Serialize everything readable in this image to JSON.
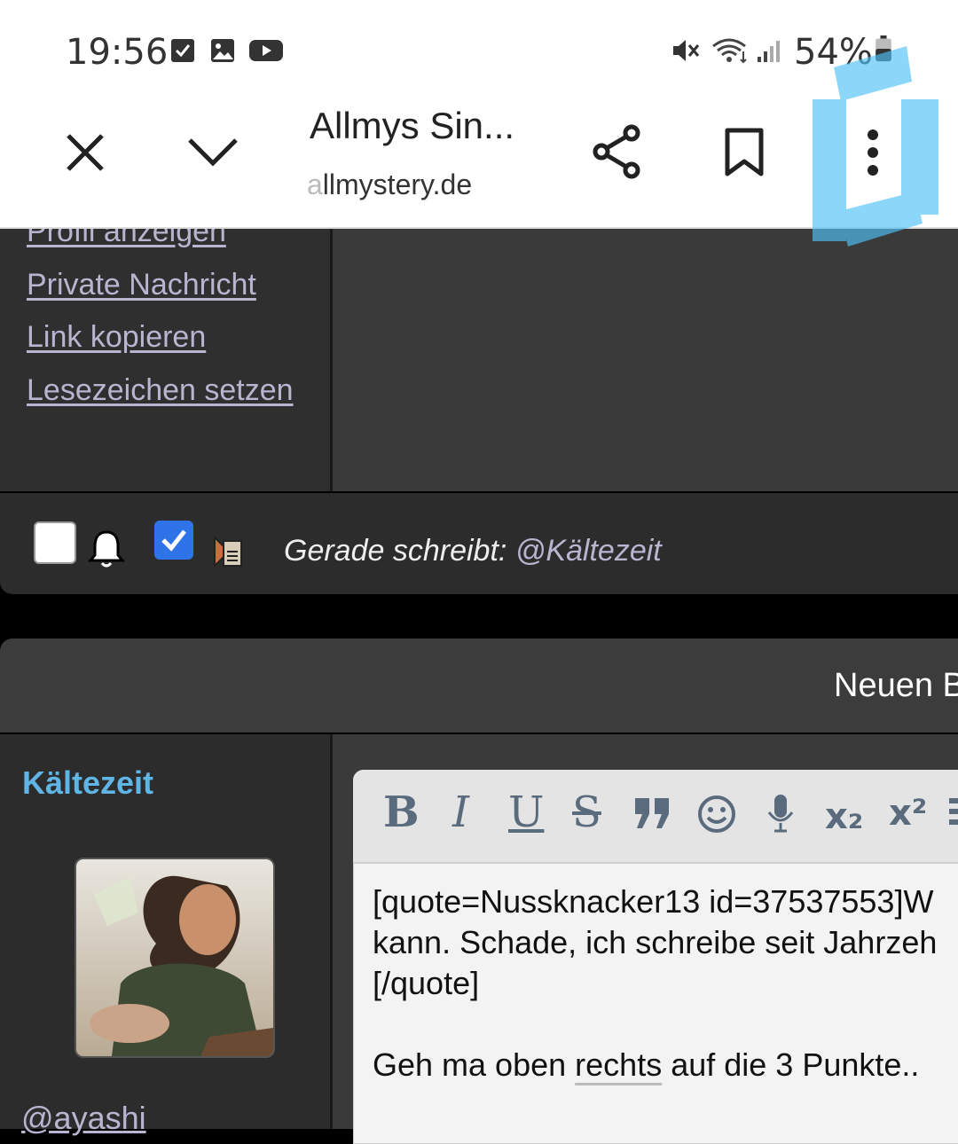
{
  "status_bar": {
    "time": "19:56",
    "battery_percent": "54%",
    "battery_level": 0.54,
    "icons": [
      "checkbox-notification-icon",
      "gallery-notification-icon",
      "youtube-notification-icon",
      "mute-icon",
      "wifi-icon",
      "signal-icon",
      "battery-icon"
    ]
  },
  "toolbar": {
    "title": "Allmys Sin...",
    "url_prefix": "a",
    "url_rest": "llmystery.de",
    "icons": [
      "close-icon",
      "chevron-down-icon",
      "share-icon",
      "bookmark-icon",
      "more-vert-icon"
    ]
  },
  "post_menu": {
    "items": [
      {
        "label": "Profil anzeigen"
      },
      {
        "label": "Private Nachricht"
      },
      {
        "label": "Link kopieren"
      },
      {
        "label": "Lesezeichen setzen"
      }
    ]
  },
  "thread_options": {
    "notify_checked": false,
    "subscribe_checked": true,
    "typing_label": "Gerade schreibt:",
    "typing_user": "@Kältezeit"
  },
  "reply": {
    "header_text": "Neuen B",
    "author_name": "Kältezeit",
    "author_handle": "@ayashi",
    "editor_buttons": [
      {
        "label": "B",
        "name": "bold-button"
      },
      {
        "label": "I",
        "name": "italic-button"
      },
      {
        "label": "U",
        "name": "underline-button"
      },
      {
        "label": "S",
        "name": "strikethrough-button"
      },
      {
        "label": "❞",
        "name": "quote-button"
      },
      {
        "label": "☺",
        "name": "emoji-button"
      },
      {
        "label": "🎤",
        "name": "microphone-button"
      },
      {
        "label": "x₂",
        "name": "subscript-button"
      },
      {
        "label": "x²",
        "name": "superscript-button"
      }
    ],
    "editor_line1": "[quote=Nussknacker13 id=37537553]W",
    "editor_line2": "kann. Schade, ich schreibe seit Jahrzeh",
    "editor_line3": "[/quote]",
    "editor_line5_a": "Geh ma oben ",
    "editor_line5_b": "rechts",
    "editor_line5_c": " auf die 3 Punkte.."
  }
}
